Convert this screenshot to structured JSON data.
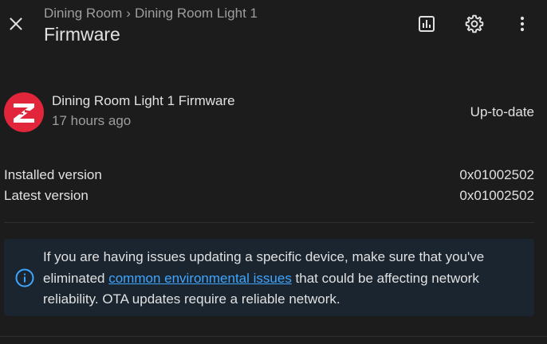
{
  "header": {
    "breadcrumb": [
      "Dining Room",
      "Dining Room Light 1"
    ],
    "breadcrumb_separator": "›",
    "title": "Firmware",
    "icons": {
      "close": "close-icon",
      "history": "history-chart-icon",
      "settings": "gear-icon",
      "more": "more-vert-icon"
    }
  },
  "entity": {
    "logo": "zigbee-icon",
    "name": "Dining Room Light 1 Firmware",
    "last_updated": "17 hours ago",
    "state": "Up-to-date"
  },
  "attributes": [
    {
      "label": "Installed version",
      "value": "0x01002502"
    },
    {
      "label": "Latest version",
      "value": "0x01002502"
    }
  ],
  "alert": {
    "icon": "info-icon",
    "text_before": "If you are having issues updating a specific device, make sure that you've eliminated ",
    "link_text": "common environmental issues",
    "text_after": " that could be affecting network reliability. OTA updates require a reliable network."
  },
  "colors": {
    "background": "#1c1c1c",
    "primary_text": "#e1e1e1",
    "secondary_text": "#9e9e9e",
    "link": "#3fa6ff",
    "alert_background": "#1a2530",
    "zigbee_red": "#e1253b"
  }
}
